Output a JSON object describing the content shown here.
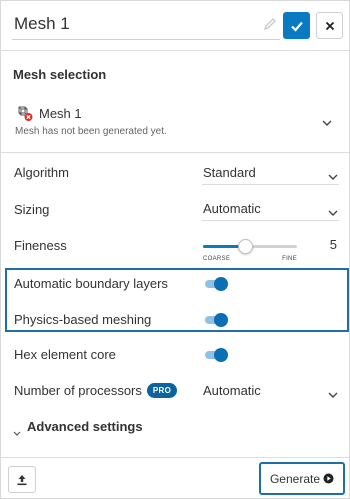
{
  "header": {
    "title": "Mesh 1"
  },
  "mesh_selection": {
    "title": "Mesh selection",
    "mesh_name": "Mesh 1",
    "status": "Mesh has not been generated yet."
  },
  "algorithm": {
    "label": "Algorithm",
    "value": "Standard"
  },
  "sizing": {
    "label": "Sizing",
    "value": "Automatic"
  },
  "fineness": {
    "label": "Fineness",
    "value": "5",
    "min": 1,
    "max": 10,
    "low_label": "COARSE",
    "high_label": "FINE"
  },
  "automatic_boundary_layers": {
    "label": "Automatic boundary layers",
    "enabled": true
  },
  "physics_based_meshing": {
    "label": "Physics-based meshing",
    "enabled": true
  },
  "hex_element_core": {
    "label": "Hex element core",
    "enabled": true
  },
  "processors": {
    "label": "Number of processors",
    "badge": "PRO",
    "value": "Automatic"
  },
  "advanced": {
    "label": "Advanced settings"
  },
  "footer": {
    "generate_label": "Generate"
  },
  "colors": {
    "accent": "#0a7ac2",
    "highlight_border": "#1e6fa9",
    "toggle_track": "#8ec2e3"
  }
}
